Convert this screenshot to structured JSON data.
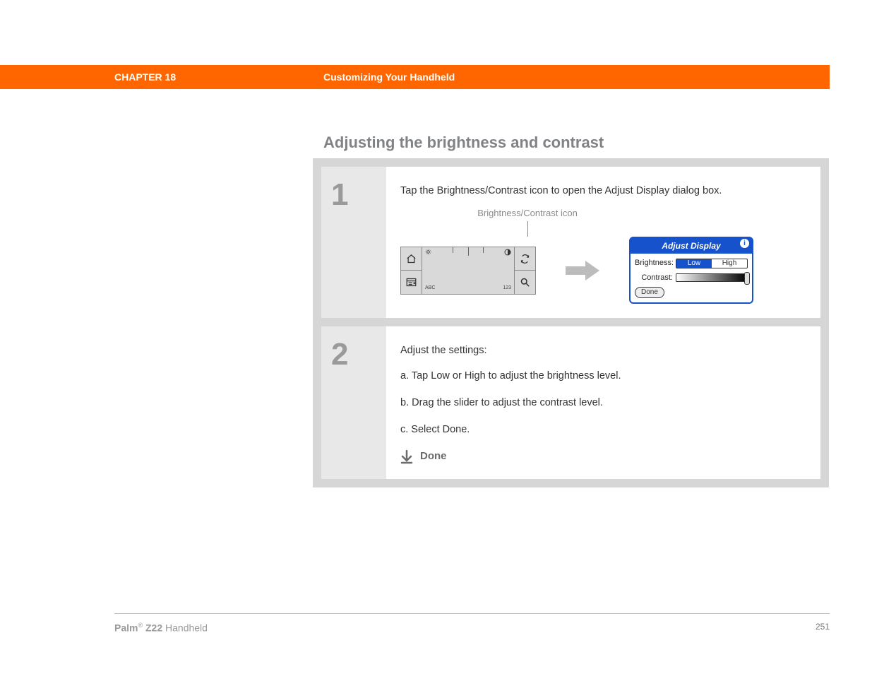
{
  "header": {
    "chapter": "CHAPTER 18",
    "title": "Customizing Your Handheld"
  },
  "section_heading": "Adjusting the brightness and contrast",
  "step1": {
    "num": "1",
    "text": "Tap the Brightness/Contrast icon to open the Adjust Display dialog box.",
    "caption": "Brightness/Contrast icon",
    "graffiti": {
      "abc": "ABC",
      "n123": "123"
    },
    "dialog": {
      "title": "Adjust Display",
      "brightness_label": "Brightness:",
      "low": "Low",
      "high": "High",
      "contrast_label": "Contrast:",
      "done": "Done"
    }
  },
  "step2": {
    "num": "2",
    "intro": "Adjust the settings:",
    "a": "a.  Tap Low or High to adjust the brightness level.",
    "b": "b.  Drag the slider to adjust the contrast level.",
    "c": "c.  Select Done.",
    "done": "Done"
  },
  "footer": {
    "brand_bold": "Palm",
    "brand_reg": "®",
    "brand_model": " Z22",
    "brand_tail": " Handheld",
    "page": "251"
  }
}
